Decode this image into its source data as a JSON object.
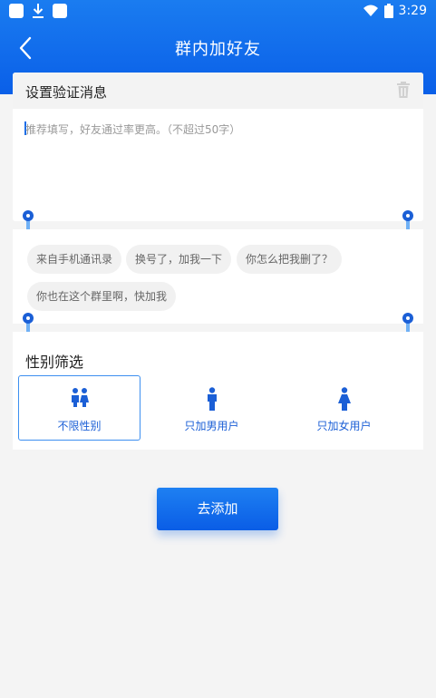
{
  "status_bar": {
    "time": "3:29",
    "icons": [
      "notification-square-icon",
      "download-icon",
      "notification-square-icon",
      "wifi-icon",
      "battery-icon"
    ]
  },
  "header": {
    "title": "群内加好友",
    "back_icon": "chevron-left-icon"
  },
  "verify_section": {
    "title": "设置验证消息",
    "trash_icon": "trash-icon",
    "input_value": "",
    "input_placeholder": "推荐填写，好友通过率更高。（不超过50字）"
  },
  "quick_messages": [
    "来自手机通讯录",
    "换号了，加我一下",
    "你怎么把我删了？",
    "你也在这个群里啊，快加我"
  ],
  "gender_filter": {
    "title": "性别筛选",
    "selected": "不限性别",
    "options": [
      {
        "label": "不限性别",
        "icon": "couple-icon"
      },
      {
        "label": "只加男用户",
        "icon": "male-icon"
      },
      {
        "label": "只加女用户",
        "icon": "female-icon"
      }
    ]
  },
  "submit_button": {
    "label": "去添加"
  },
  "colors": {
    "primary": "#0a5fe8",
    "accent_text": "#1b5fd6",
    "background": "#f4f4f4"
  }
}
